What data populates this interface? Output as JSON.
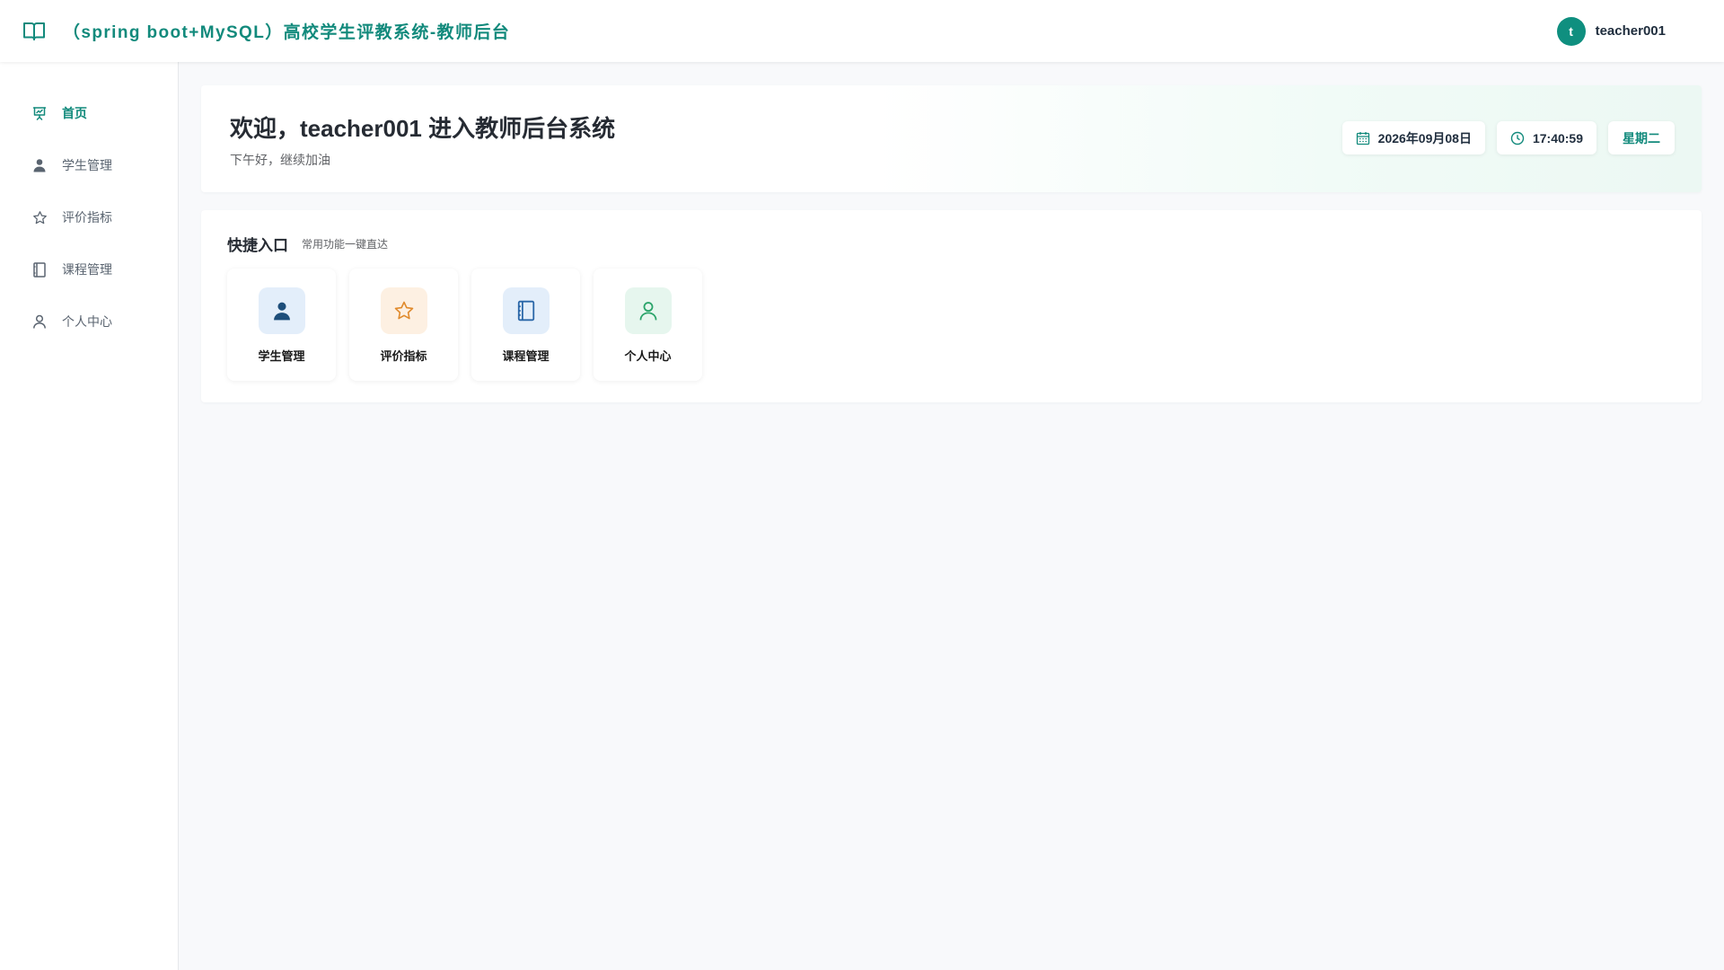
{
  "header": {
    "brand_icon": "book-open-icon",
    "title": "（spring boot+MySQL）高校学生评教系统-教师后台",
    "avatar_initial": "t",
    "username": "teacher001",
    "accent_color": "#128a7c"
  },
  "sidebar": {
    "items": [
      {
        "label": "首页",
        "icon": "presentation-chart-icon",
        "active": true
      },
      {
        "label": "学生管理",
        "icon": "user-icon",
        "active": false
      },
      {
        "label": "评价指标",
        "icon": "star-icon",
        "active": false
      },
      {
        "label": "课程管理",
        "icon": "notebook-icon",
        "active": false
      },
      {
        "label": "个人中心",
        "icon": "user-outline-icon",
        "active": false
      }
    ]
  },
  "welcome": {
    "title": "欢迎，teacher001 进入教师后台系统",
    "subtitle": "下午好，继续加油",
    "date": "2026年09月08日",
    "time": "17:40:59",
    "weekday": "星期二"
  },
  "quick": {
    "title": "快捷入口",
    "subtitle": "常用功能一键直达",
    "cards": [
      {
        "label": "学生管理",
        "icon": "user-icon",
        "bg": "#e3eefa",
        "color": "#1d4e7a"
      },
      {
        "label": "评价指标",
        "icon": "star-icon",
        "bg": "#fdf0e2",
        "color": "#e08a2c"
      },
      {
        "label": "课程管理",
        "icon": "notebook-icon",
        "bg": "#e3eefa",
        "color": "#2a67a8"
      },
      {
        "label": "个人中心",
        "icon": "user-outline-icon",
        "bg": "#e6f6ee",
        "color": "#2aa46a"
      }
    ]
  }
}
